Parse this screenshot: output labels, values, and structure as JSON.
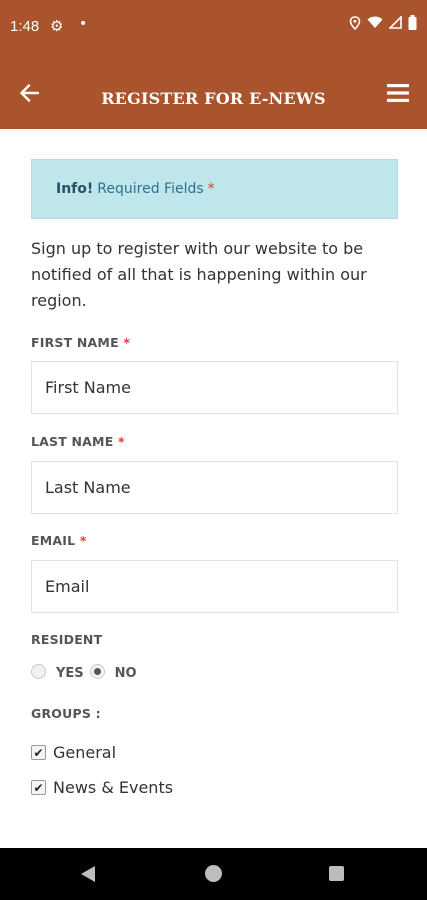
{
  "status_bar": {
    "time": "1:48"
  },
  "app_bar": {
    "title": "REGISTER FOR E-NEWS"
  },
  "info": {
    "strong": "Info!",
    "text": "Required Fields",
    "star": "*"
  },
  "intro": "Sign up to register with our website to be notified of all that is happening within our region.",
  "form": {
    "first_name": {
      "label": "FIRST NAME",
      "star": "*",
      "placeholder": "First Name"
    },
    "last_name": {
      "label": "LAST NAME",
      "star": "*",
      "placeholder": "Last Name"
    },
    "email": {
      "label": "EMAIL",
      "star": "*",
      "placeholder": "Email"
    },
    "resident": {
      "label": "RESIDENT",
      "options": [
        "YES",
        "NO"
      ],
      "selected": "NO"
    },
    "groups": {
      "label": "GROUPS :",
      "items": [
        {
          "label": "General",
          "checked": true
        },
        {
          "label": "News & Events",
          "checked": true
        }
      ]
    }
  },
  "colors": {
    "brand": "#a9542d",
    "info_bg": "#bfe6ea",
    "required": "#e53935"
  }
}
